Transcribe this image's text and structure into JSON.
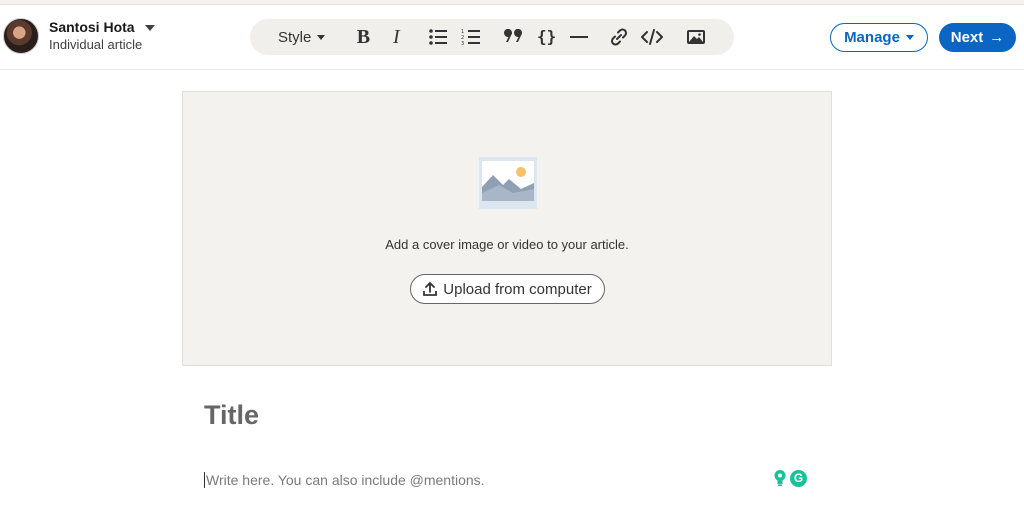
{
  "author": {
    "name": "Santosi Hota",
    "subtitle": "Individual article"
  },
  "toolbar": {
    "style_label": "Style",
    "bold_label": "B",
    "italic_label": "I",
    "buttons": [
      "bold-icon",
      "italic-icon",
      "bulleted-list-icon",
      "numbered-list-icon",
      "quote-icon",
      "code-braces-icon",
      "divider-icon",
      "link-icon",
      "code-embed-icon",
      "image-icon"
    ]
  },
  "actions": {
    "manage_label": "Manage",
    "next_label": "Next"
  },
  "cover": {
    "prompt": "Add a cover image or video to your article.",
    "upload_label": "Upload from computer"
  },
  "editor": {
    "title_placeholder": "Title",
    "body_placeholder": "Write here. You can also include @mentions."
  },
  "colors": {
    "accent": "#0a66c2",
    "grammarly": "#15c39a"
  }
}
